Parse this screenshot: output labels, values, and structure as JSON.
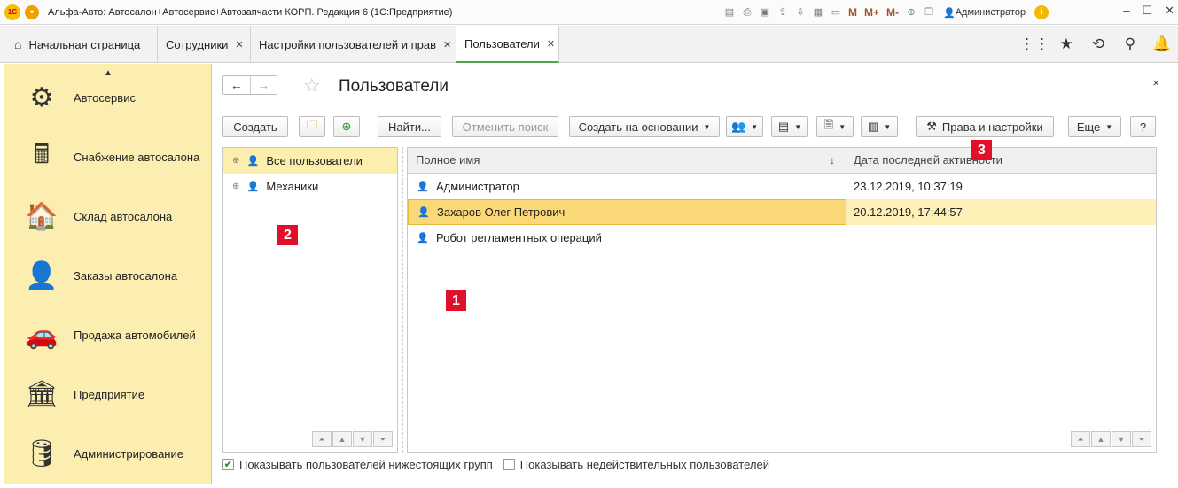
{
  "titlebar": {
    "logo": "1С",
    "title": "Альфа-Авто: Автосалон+Автосервис+Автозапчасти КОРП. Редакция 6  (1С:Предприятие)",
    "mem_buttons": [
      "M",
      "M+",
      "M-"
    ],
    "user": "Администратор",
    "icons": [
      "save-icon",
      "print-icon",
      "preview-icon",
      "upload-icon",
      "download-icon",
      "calculator-icon",
      "calendar-icon",
      "zoom-icon",
      "window-icon"
    ]
  },
  "tabs": [
    {
      "label": "Начальная страница",
      "icon": "home-icon"
    },
    {
      "label": "Сотрудники",
      "close": "✕"
    },
    {
      "label": "Настройки пользователей и прав",
      "close": "✕"
    },
    {
      "label": "Пользователи",
      "close": "✕",
      "active": true
    }
  ],
  "sidebar": {
    "items": [
      {
        "label": "Автосервис",
        "icon": "gear-wheel-icon"
      },
      {
        "label": "Снабжение автосалона",
        "icon": "calculator-icon"
      },
      {
        "label": "Склад автосалона",
        "icon": "garage-icon"
      },
      {
        "label": "Заказы автосалона",
        "icon": "manager-icon"
      },
      {
        "label": "Продажа автомобилей",
        "icon": "car-icon"
      },
      {
        "label": "Предприятие",
        "icon": "building-icon"
      },
      {
        "label": "Администрирование",
        "icon": "database-icon"
      }
    ]
  },
  "form": {
    "title": "Пользователи",
    "close": "×",
    "toolbar": {
      "create": "Создать",
      "find": "Найти...",
      "cancel_search": "Отменить поиск",
      "create_based_on": "Создать на основании",
      "rights": "Права и настройки",
      "more": "Еще",
      "help": "?"
    }
  },
  "groups_tree": [
    {
      "label": "Все пользователи",
      "selected": true
    },
    {
      "label": "Механики"
    }
  ],
  "users_list": {
    "columns": [
      "Полное имя",
      "Дата последней активности"
    ],
    "sort_indicator": "↓",
    "rows": [
      {
        "name": "Администратор",
        "date": "23.12.2019, 10:37:19"
      },
      {
        "name": "Захаров Олег Петрович",
        "date": "20.12.2019, 17:44:57",
        "selected": true
      },
      {
        "name": "Робот регламентных операций",
        "date": ""
      }
    ]
  },
  "badges": {
    "list": "1",
    "tree": "2",
    "rights": "3"
  },
  "checkboxes": {
    "show_subgroups": {
      "label": "Показывать пользователей нижестоящих групп",
      "checked": true
    },
    "show_invalid": {
      "label": "Показывать недействительных пользователей",
      "checked": false
    }
  },
  "colors": {
    "sidebar": "#fbeeb0",
    "selection": "#fad877",
    "badge": "#e0102a",
    "active_tab": "#4ca64c"
  }
}
